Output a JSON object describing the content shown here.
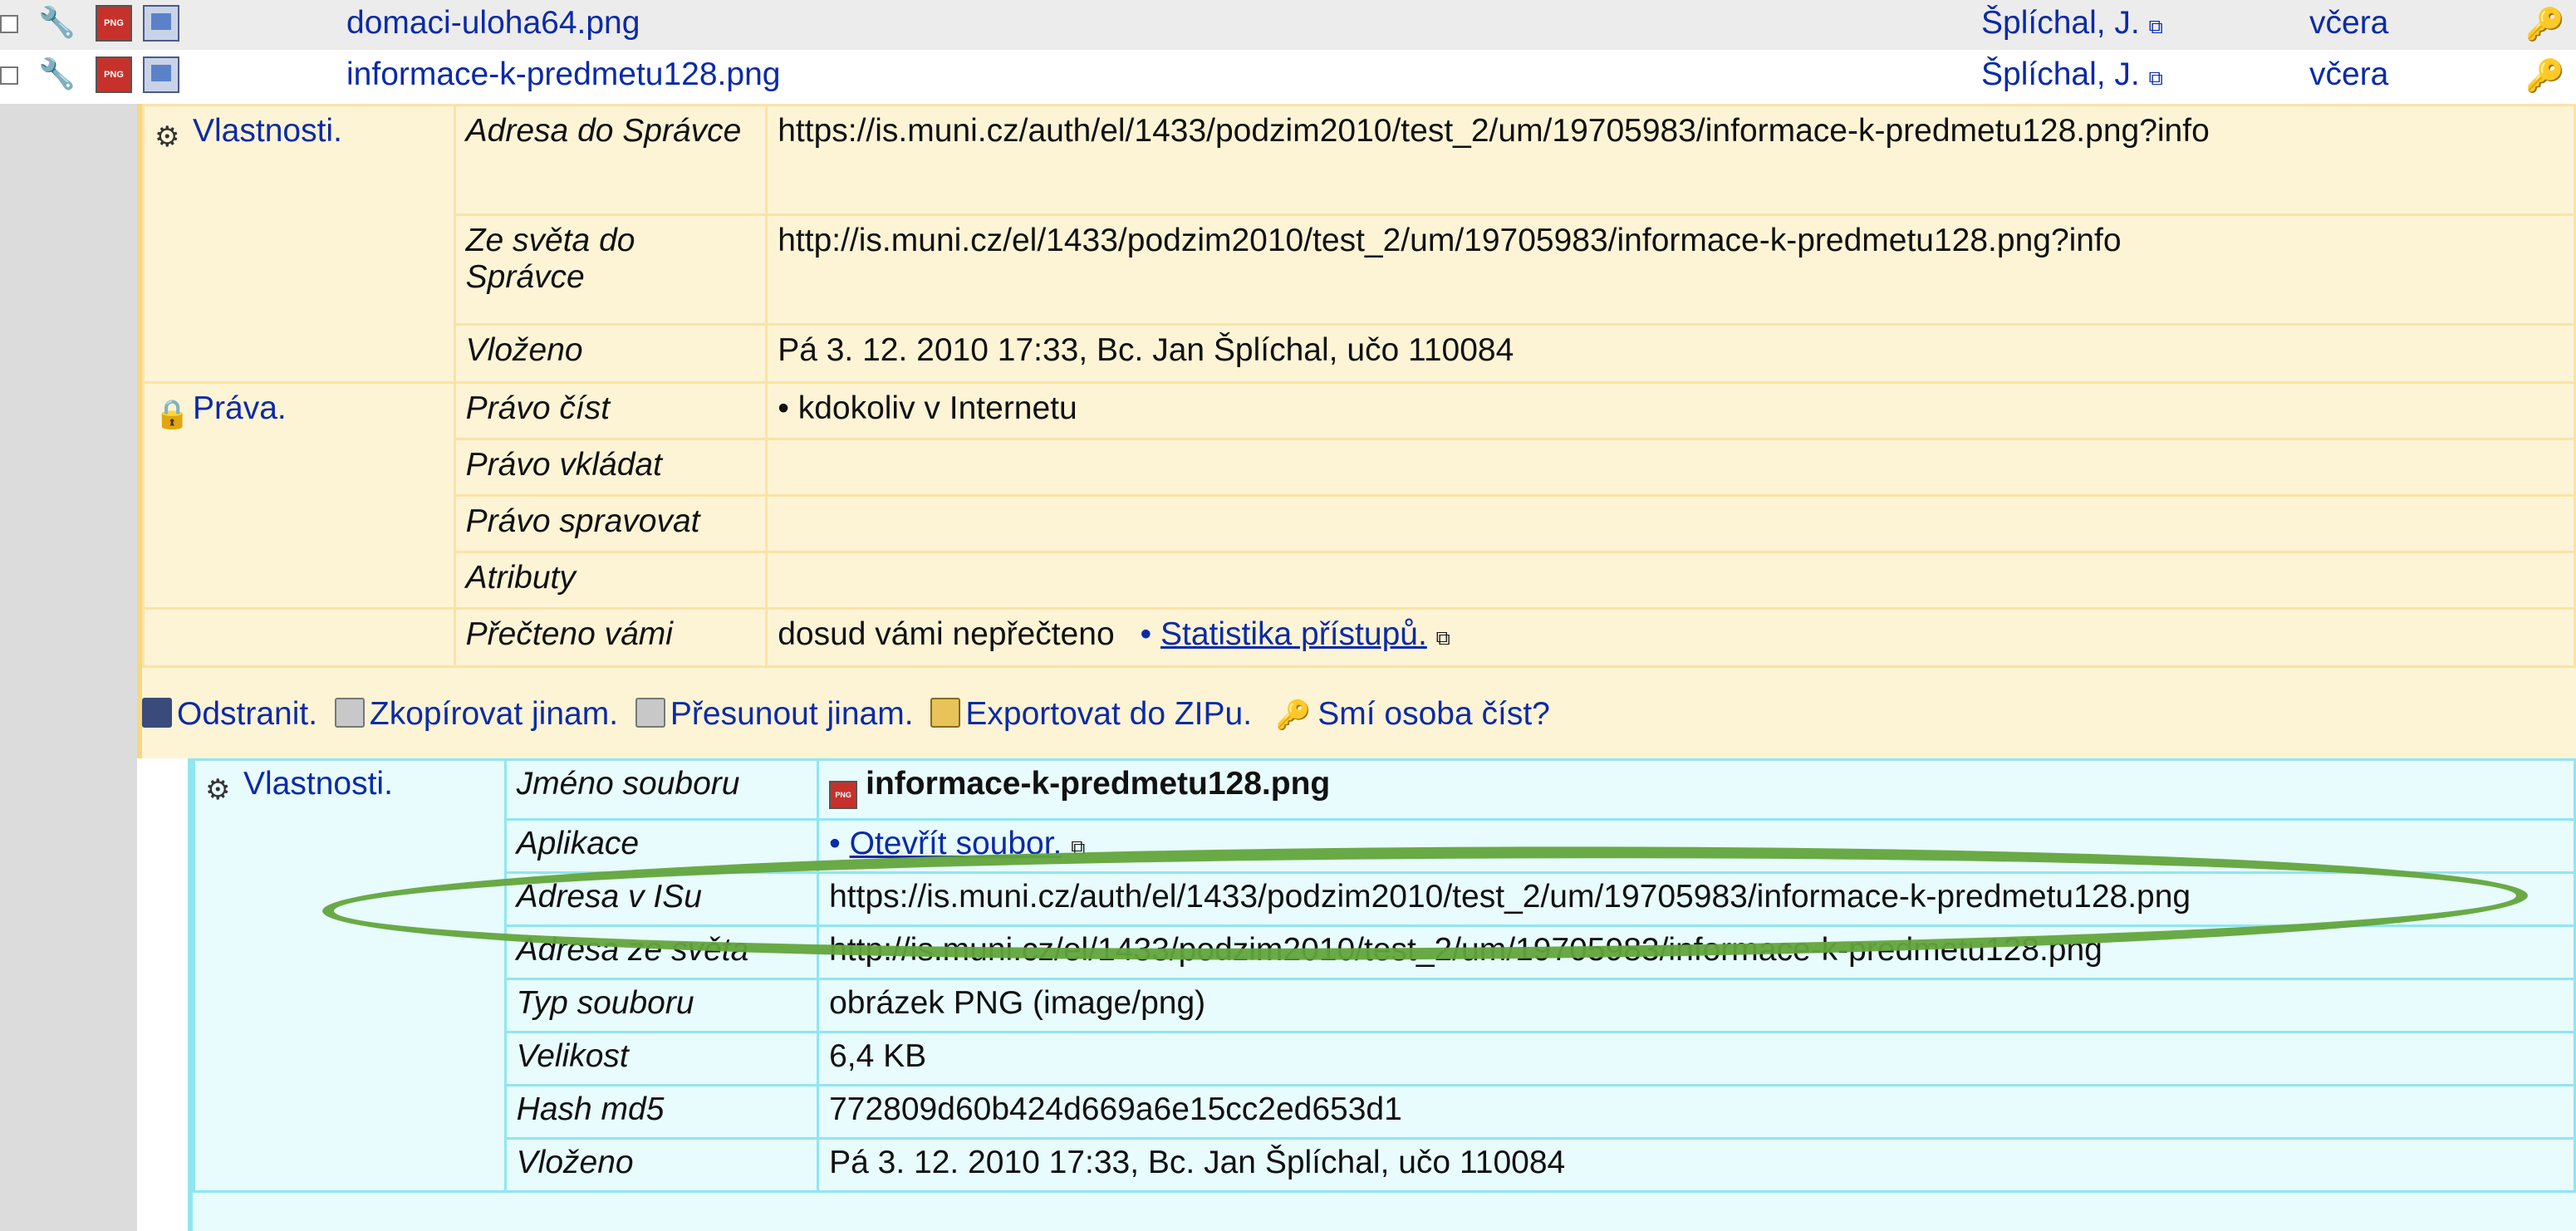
{
  "files": [
    {
      "name": "domaci-uloha64.png",
      "author": "Šplíchal, J.",
      "date": "včera"
    },
    {
      "name": "informace-k-predmetu128.png",
      "author": "Šplíchal, J.",
      "date": "včera"
    }
  ],
  "properties": {
    "section_label": "Vlastnosti.",
    "rows": [
      {
        "label": "Adresa do Správce",
        "value": "https://is.muni.cz/auth/el/1433/podzim2010/test_2/um/19705983/informace-k-predmetu128.png?info"
      },
      {
        "label": "Ze světa do Správce",
        "value": "http://is.muni.cz/el/1433/podzim2010/test_2/um/19705983/informace-k-predmetu128.png?info"
      },
      {
        "label": "Vloženo",
        "value": "Pá 3. 12. 2010 17:33, Bc. Jan Šplíchal, učo 110084"
      }
    ]
  },
  "rights": {
    "section_label": "Práva.",
    "rows": [
      {
        "label": "Právo číst",
        "value": "• kdokoliv v Internetu"
      },
      {
        "label": "Právo vkládat",
        "value": ""
      },
      {
        "label": "Právo spravovat",
        "value": ""
      },
      {
        "label": "Atributy",
        "value": ""
      }
    ]
  },
  "read": {
    "label": "Přečteno vámi",
    "value": "dosud vámi nepřečteno",
    "link": "Statistika přístupů."
  },
  "actions": {
    "remove": "Odstranit.",
    "copy": "Zkopírovat jinam.",
    "move": "Přesunout jinam.",
    "export": "Exportovat do ZIPu.",
    "may_read": "Smí osoba číst?"
  },
  "file_properties": {
    "section_label": "Vlastnosti.",
    "name_label": "Jméno souboru",
    "name_value": "informace-k-predmetu128.png",
    "app_label": "Aplikace",
    "app_link": "Otevřít soubor.",
    "rows": [
      {
        "label": "Adresa v ISu",
        "value": "https://is.muni.cz/auth/el/1433/podzim2010/test_2/um/19705983/informace-k-predmetu128.png"
      },
      {
        "label": "Adresa ze světa",
        "value": "http://is.muni.cz/el/1433/podzim2010/test_2/um/19705983/informace-k-predmetu128.png"
      },
      {
        "label": "Typ souboru",
        "value": "obrázek PNG (image/png)"
      },
      {
        "label": "Velikost",
        "value": "6,4 KB"
      },
      {
        "label": "Hash md5",
        "value": "772809d60b424d669a6e15cc2ed653d1"
      },
      {
        "label": "Vloženo",
        "value": "Pá 3. 12. 2010 17:33, Bc. Jan Šplíchal, učo 110084"
      }
    ]
  },
  "colors": {
    "link": "#0a2aa8",
    "yellow_bg": "#fdf4d6",
    "cyan_bg": "#e8fbfd",
    "highlight_oval": "#62a53c"
  }
}
